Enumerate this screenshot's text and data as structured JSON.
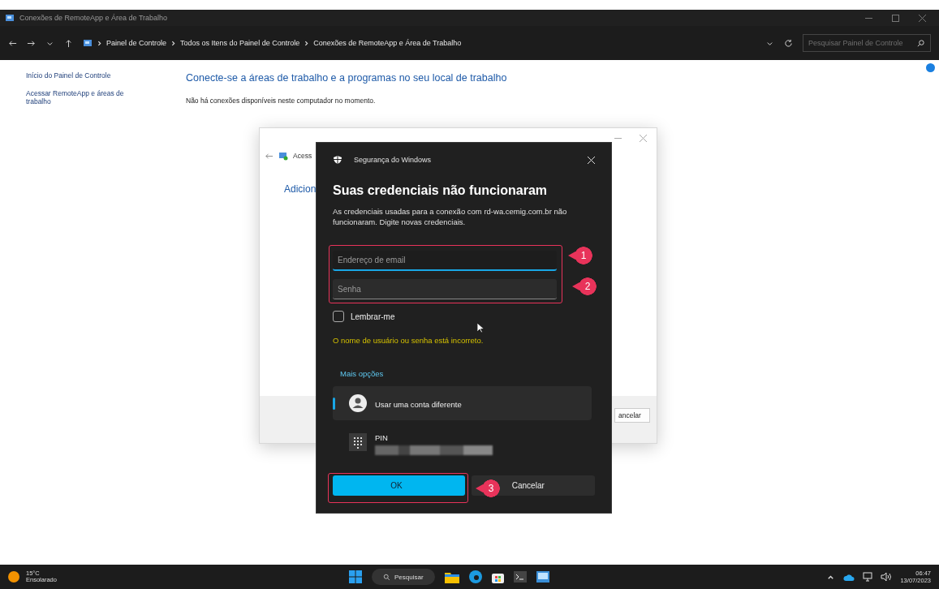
{
  "window": {
    "title": "Conexões de RemoteApp e Área de Trabalho"
  },
  "address_bar": {
    "breadcrumb": [
      "Painel de Controle",
      "Todos os Itens do Painel de Controle",
      "Conexões de RemoteApp e Área de Trabalho"
    ],
    "search": {
      "placeholder": "Pesquisar Painel de Controle"
    }
  },
  "sidebar": {
    "items": [
      {
        "label": "Início do Painel de Controle"
      },
      {
        "label": "Acessar RemoteApp e áreas de trabalho"
      }
    ]
  },
  "main": {
    "heading": "Conecte-se a áreas de trabalho e a programas no seu local de trabalho",
    "message": "Não há conexões disponíveis neste computador no momento."
  },
  "background_dialog": {
    "title": "Acess",
    "heading": "Adicion",
    "button": "ancelar"
  },
  "security_dialog": {
    "app_title": "Segurança do Windows",
    "heading": "Suas credenciais não funcionaram",
    "description": "As credenciais usadas para a conexão com rd-wa.cemig.com.br não funcionaram. Digite novas credenciais.",
    "fields": [
      {
        "placeholder": "Endereço de email",
        "focused": true
      },
      {
        "placeholder": "Senha",
        "focused": false
      }
    ],
    "remember": {
      "label": "Lembrar-me",
      "checked": false
    },
    "error": "O nome de usuário ou senha está incorreto.",
    "more_options": "Mais opções",
    "options": [
      {
        "kind": "account",
        "label": "Usar uma conta diferente",
        "selected": true
      },
      {
        "kind": "pin",
        "label": "PIN",
        "selected": false
      }
    ],
    "buttons": [
      {
        "label": "OK",
        "primary": true
      },
      {
        "label": "Cancelar",
        "primary": false
      }
    ]
  },
  "annotations": [
    {
      "number": "1"
    },
    {
      "number": "2"
    },
    {
      "number": "3"
    }
  ],
  "taskbar": {
    "weather": {
      "temperature": "15°C",
      "condition": "Ensolarado"
    },
    "search": "Pesquisar",
    "time": "06:47",
    "date": "13/07/2023"
  }
}
